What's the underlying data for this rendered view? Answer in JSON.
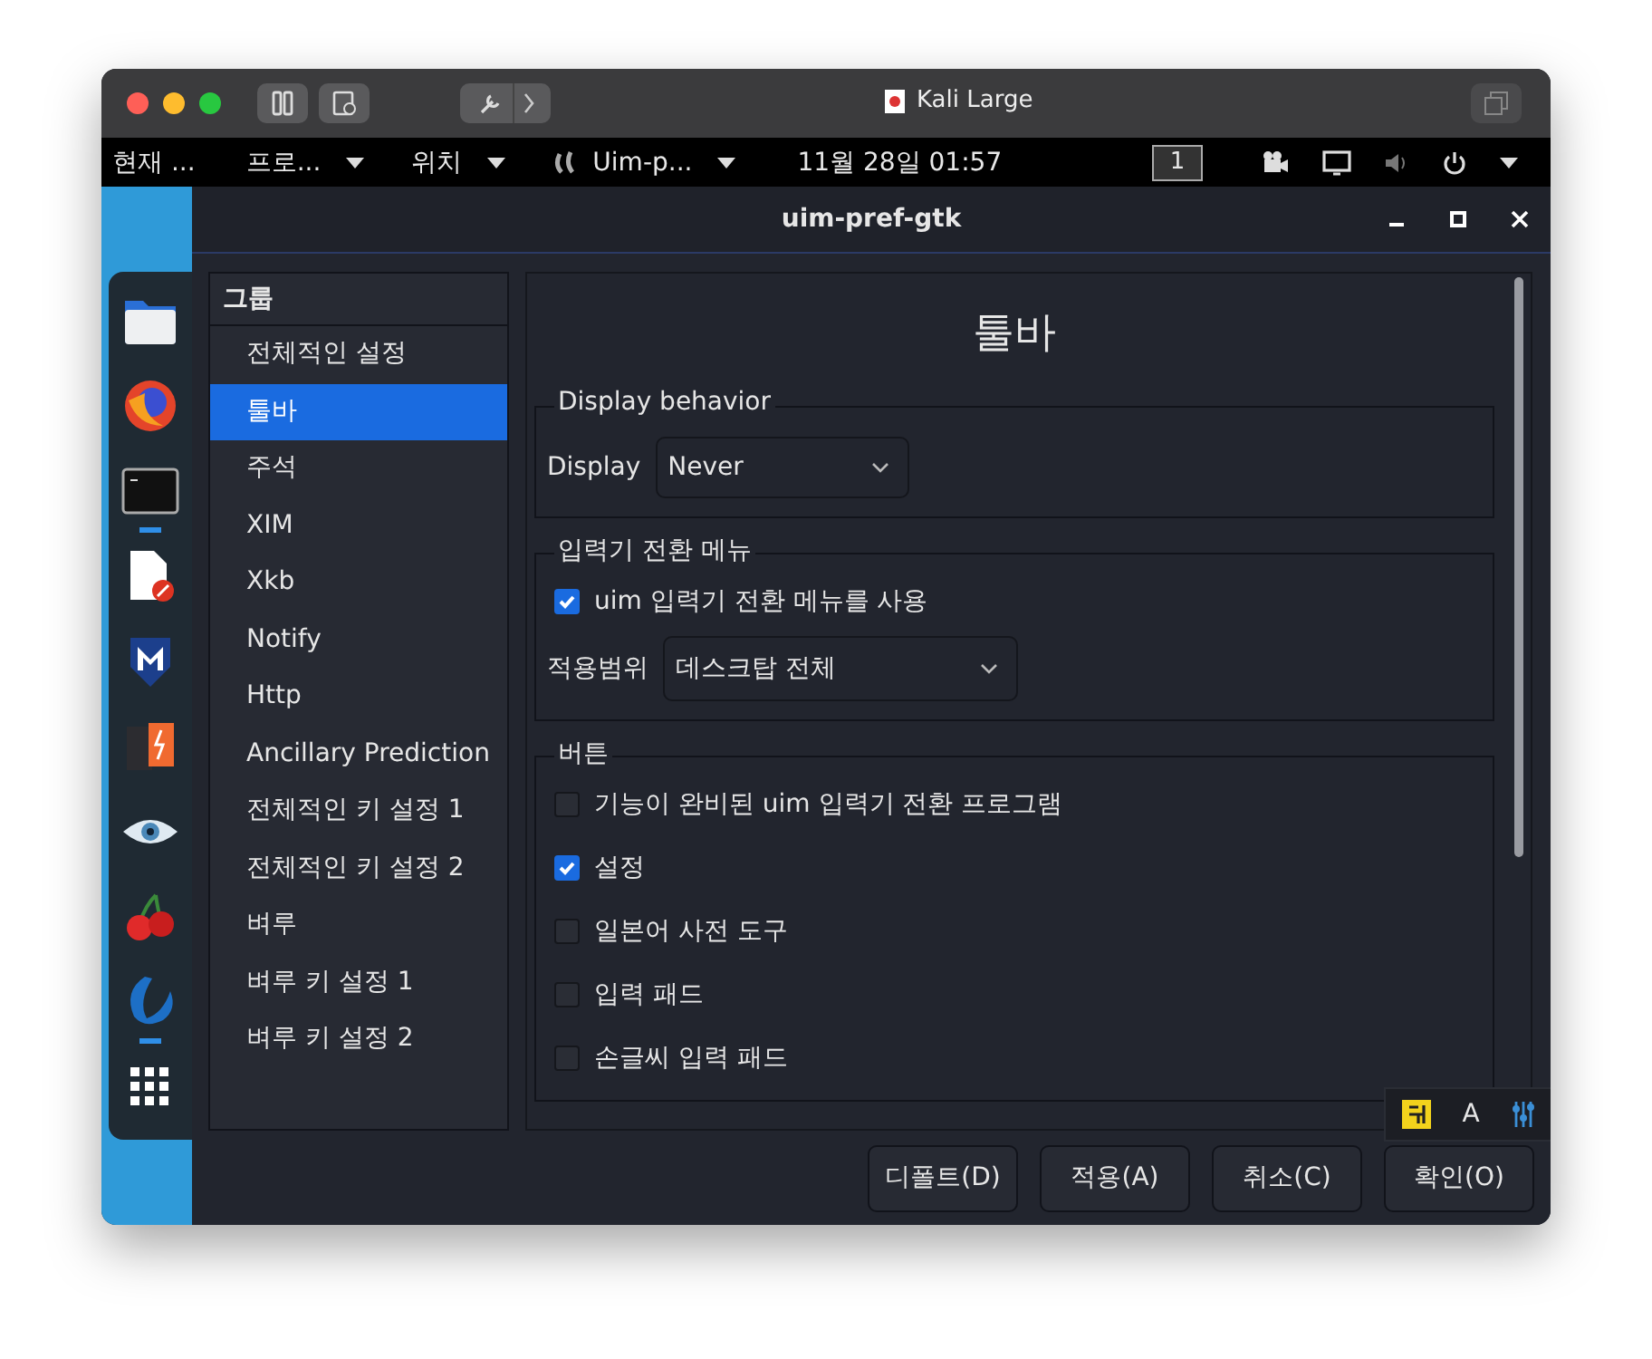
{
  "mac_window": {
    "title": "Kali Large"
  },
  "top_panel": {
    "activities": "현재 ...",
    "menus": [
      {
        "label": "프로...",
        "icon": false
      },
      {
        "label": "위치",
        "icon": false
      },
      {
        "label": "Uim-p...",
        "icon": true
      }
    ],
    "clock": "11월 28일  01:57",
    "workspace": "1"
  },
  "dock": [
    {
      "kind": "folder",
      "running": false
    },
    {
      "kind": "globe",
      "running": false
    },
    {
      "kind": "terminal",
      "running": true
    },
    {
      "kind": "document",
      "running": false
    },
    {
      "kind": "shield",
      "running": false
    },
    {
      "kind": "box",
      "running": false
    },
    {
      "kind": "eye",
      "running": false
    },
    {
      "kind": "cherry",
      "running": false
    },
    {
      "kind": "swoosh",
      "running": true
    },
    {
      "kind": "grid",
      "running": false
    }
  ],
  "app_window": {
    "title": "uim-pref-gtk"
  },
  "groups": {
    "header": "그룹",
    "items": [
      {
        "label": "전체적인 설정",
        "selected": false
      },
      {
        "label": "툴바",
        "selected": true
      },
      {
        "label": "주석",
        "selected": false
      },
      {
        "label": "XIM",
        "selected": false
      },
      {
        "label": "Xkb",
        "selected": false
      },
      {
        "label": "Notify",
        "selected": false
      },
      {
        "label": "Http",
        "selected": false
      },
      {
        "label": "Ancillary Prediction",
        "selected": false
      },
      {
        "label": "전체적인 키 설정 1",
        "selected": false
      },
      {
        "label": "전체적인 키 설정 2",
        "selected": false
      },
      {
        "label": "벼루",
        "selected": false
      },
      {
        "label": "벼루 키 설정 1",
        "selected": false
      },
      {
        "label": "벼루 키 설정 2",
        "selected": false
      }
    ]
  },
  "page_title": "툴바",
  "sections": [
    {
      "legend": "Display behavior",
      "items": [
        {
          "kind": "dropdown",
          "label": "Display",
          "value": "Never"
        }
      ]
    },
    {
      "legend": "입력기 전환 메뉴",
      "items": [
        {
          "kind": "checkbox",
          "label": "uim 입력기 전환 메뉴를 사용",
          "checked": true
        },
        {
          "kind": "dropdown",
          "label": "적용범위",
          "value": "데스크탑 전체"
        }
      ]
    },
    {
      "legend": "버튼",
      "items": [
        {
          "kind": "checkbox",
          "label": "기능이 완비된 uim 입력기 전환 프로그램",
          "checked": false
        },
        {
          "kind": "checkbox",
          "label": "설정",
          "checked": true
        },
        {
          "kind": "checkbox",
          "label": "일본어 사전 도구",
          "checked": false
        },
        {
          "kind": "checkbox",
          "label": "입력 패드",
          "checked": false
        },
        {
          "kind": "checkbox",
          "label": "손글씨 입력 패드",
          "checked": false
        }
      ]
    }
  ],
  "buttons": [
    "디폴트(D)",
    "적용(A)",
    "취소(C)",
    "확인(O)"
  ],
  "tray": {
    "text": "A"
  }
}
